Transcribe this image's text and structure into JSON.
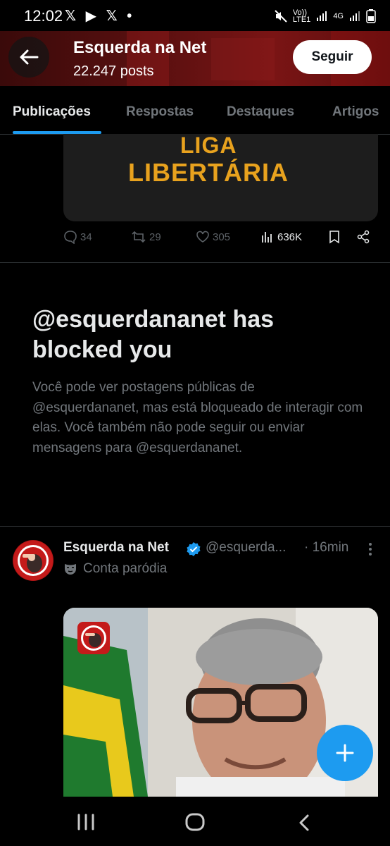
{
  "status_bar": {
    "time": "12:02",
    "icons": "𝕏 ▶ 𝕏 •",
    "network_volte": "Vo))",
    "network_lte": "LTE1",
    "network_4g": "4G"
  },
  "header": {
    "title": "Esquerda na Net",
    "post_count": "22.247 posts",
    "follow_label": "Seguir"
  },
  "tabs": [
    "Publicações",
    "Respostas",
    "Destaques",
    "Artigos"
  ],
  "previous_post": {
    "image_text_line1": "LIGA",
    "image_text_line2": "LIBERTÁRIA",
    "replies": "34",
    "reposts": "29",
    "likes": "305",
    "views": "636K"
  },
  "blocked": {
    "title": "@esquerdananet has blocked you",
    "message": "Você pode ver postagens públicas de @esquerdananet, mas está bloqueado de interagir com elas. Você também não pode seguir ou enviar mensagens para @esquerdananet."
  },
  "tweet": {
    "name": "Esquerda na Net",
    "handle": "@esquerda...",
    "time": "· 16min",
    "label": "Conta paródia"
  },
  "colors": {
    "accent": "#1d9bf0",
    "header_bg": "#6a1212",
    "liga_text": "#e8a21e",
    "muted": "#71767b"
  }
}
